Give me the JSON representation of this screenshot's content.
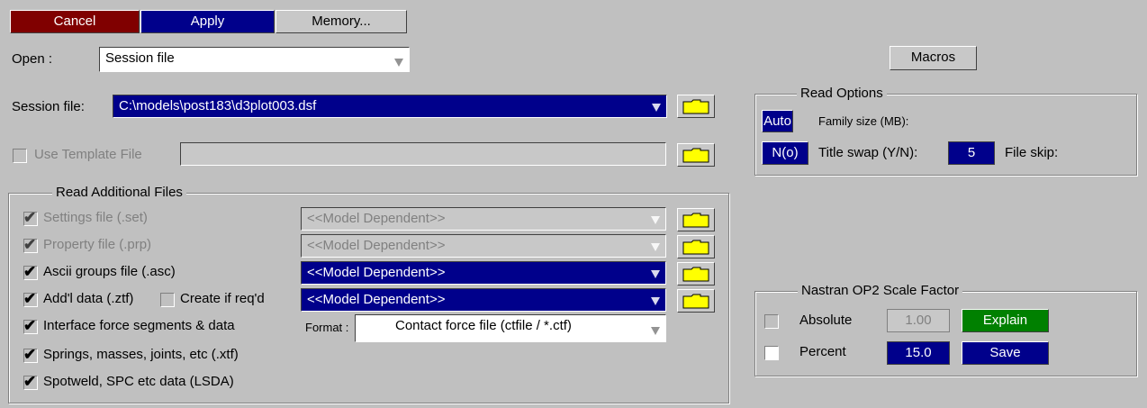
{
  "toolbar": {
    "cancel": "Cancel",
    "apply": "Apply",
    "memory": "Memory..."
  },
  "open": {
    "label": "Open :",
    "value": "Session file"
  },
  "macros": "Macros",
  "session": {
    "label": "Session file:",
    "value": "C:\\models\\post183\\d3plot003.dsf"
  },
  "template": {
    "label": "Use Template File",
    "checked": false
  },
  "read_additional": {
    "title": "Read Additional Files",
    "items": [
      {
        "label": "Settings file (.set)",
        "checked": true,
        "enabled": false,
        "dropdown": "<<Model Dependent>>"
      },
      {
        "label": "Property file (.prp)",
        "checked": true,
        "enabled": false,
        "dropdown": "<<Model Dependent>>"
      },
      {
        "label": "Ascii groups file (.asc)",
        "checked": true,
        "enabled": true,
        "dropdown": "<<Model Dependent>>"
      },
      {
        "label": "Add'l data (.ztf)",
        "checked": true,
        "enabled": true,
        "dropdown": "<<Model Dependent>>"
      },
      {
        "label": "Interface force segments & data",
        "checked": true,
        "enabled": true
      },
      {
        "label": "Springs, masses, joints, etc (.xtf)",
        "checked": true,
        "enabled": true
      },
      {
        "label": "Spotweld, SPC etc data (LSDA)",
        "checked": true,
        "enabled": true
      }
    ],
    "create_if_reqd": {
      "label": "Create if req'd",
      "checked": false
    },
    "format_label": "Format :",
    "format_value": "Contact force file (ctfile / *.ctf)"
  },
  "read_options": {
    "title": "Read Options",
    "family_btn": "Auto",
    "family_label": "Family size (MB):",
    "title_swap_btn": "N(o)",
    "title_swap_label": "Title swap (Y/N):",
    "file_skip_value": "5",
    "file_skip_label": "File skip:"
  },
  "nastran": {
    "title": "Nastran OP2 Scale Factor",
    "absolute_label": "Absolute",
    "absolute_value": "1.00",
    "absolute_checked": false,
    "percent_label": "Percent",
    "percent_value": "15.0",
    "percent_checked": false,
    "explain": "Explain",
    "save": "Save"
  },
  "colors": {
    "background": "#c0c0c0",
    "selected_blue": "#00008b",
    "cancel_red": "#800000",
    "explain_green": "#008000",
    "folder_yellow": "#ffff00"
  }
}
